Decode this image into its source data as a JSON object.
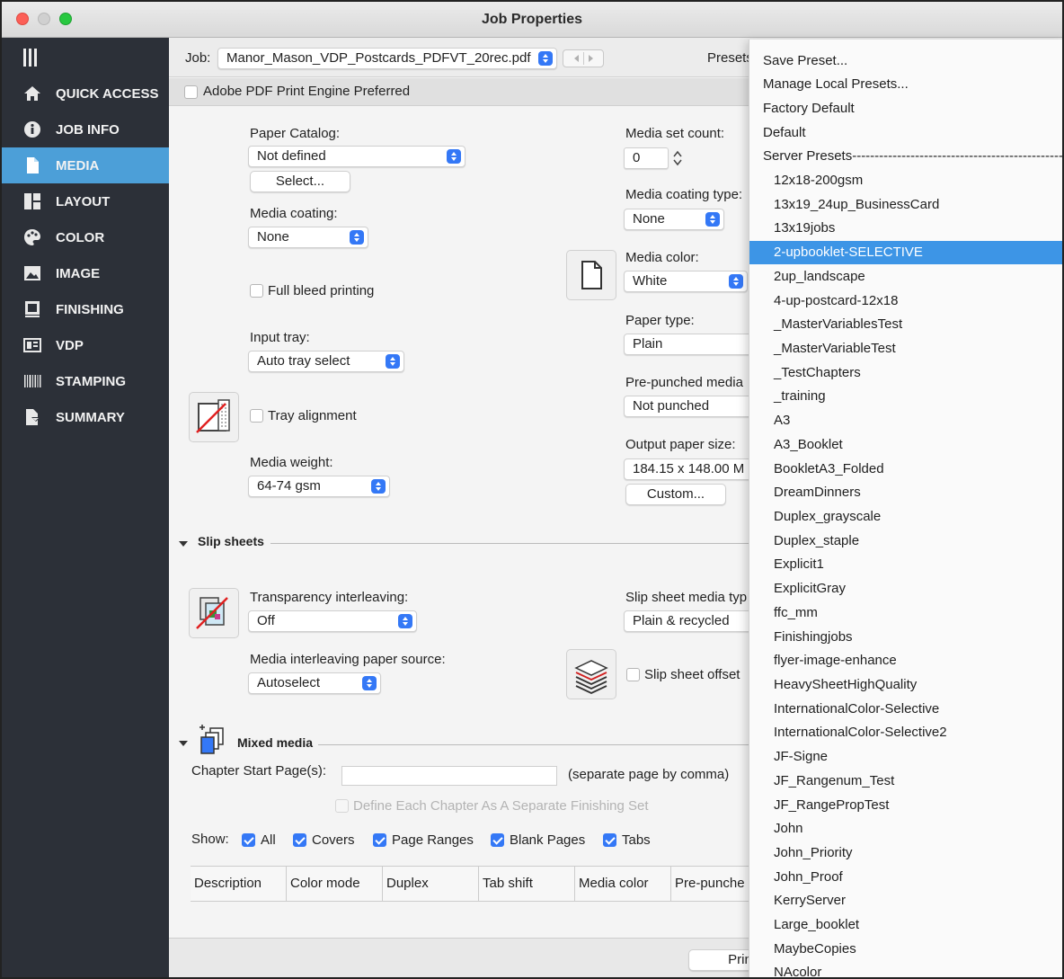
{
  "window": {
    "title": "Job Properties"
  },
  "sidebar": {
    "items": [
      {
        "label": "QUICK ACCESS",
        "icon": "home-icon"
      },
      {
        "label": "JOB INFO",
        "icon": "info-icon"
      },
      {
        "label": "MEDIA",
        "icon": "media-icon",
        "active": true
      },
      {
        "label": "LAYOUT",
        "icon": "layout-icon"
      },
      {
        "label": "COLOR",
        "icon": "palette-icon"
      },
      {
        "label": "IMAGE",
        "icon": "image-icon"
      },
      {
        "label": "FINISHING",
        "icon": "finishing-icon"
      },
      {
        "label": "VDP",
        "icon": "vdp-icon"
      },
      {
        "label": "STAMPING",
        "icon": "barcode-icon"
      },
      {
        "label": "SUMMARY",
        "icon": "summary-icon"
      }
    ]
  },
  "job": {
    "label": "Job:",
    "value": "Manor_Mason_VDP_Postcards_PDFVT_20rec.pdf",
    "presets_label": "Presets"
  },
  "pdf_engine": {
    "label": "Adobe PDF Print Engine Preferred",
    "checked": false
  },
  "media": {
    "paper_catalog_label": "Paper Catalog:",
    "paper_catalog_value": "Not defined",
    "select_button": "Select...",
    "media_coating_label": "Media coating:",
    "media_coating_value": "None",
    "full_bleed_label": "Full bleed printing",
    "input_tray_label": "Input tray:",
    "input_tray_value": "Auto tray select",
    "tray_alignment_label": "Tray alignment",
    "media_weight_label": "Media weight:",
    "media_weight_value": "64-74 gsm",
    "media_set_count_label": "Media set count:",
    "media_set_count_value": "0",
    "media_coating_type_label": "Media coating type:",
    "media_coating_type_value": "None",
    "media_color_label": "Media color:",
    "media_color_value": "White",
    "paper_type_label": "Paper type:",
    "paper_type_value": "Plain",
    "pre_punched_label": "Pre-punched media",
    "pre_punched_value": "Not punched",
    "output_paper_size_label": "Output paper size:",
    "output_paper_size_value": "184.15 x 148.00 M",
    "custom_button": "Custom..."
  },
  "slip_sheets": {
    "header": "Slip sheets",
    "transparency_label": "Transparency interleaving:",
    "transparency_value": "Off",
    "media_interleaving_label": "Media interleaving paper source:",
    "media_interleaving_value": "Autoselect",
    "slip_media_type_label": "Slip sheet media typ",
    "slip_media_type_value": "Plain & recycled",
    "slip_offset_label": "Slip sheet offset"
  },
  "mixed_media": {
    "header": "Mixed media",
    "chapter_label": "Chapter Start Page(s):",
    "chapter_value": "",
    "chapter_hint": "(separate page by comma)",
    "define_chapter_label": "Define Each Chapter As A Separate Finishing Set",
    "show_label": "Show:",
    "filters": [
      {
        "label": "All",
        "checked": true
      },
      {
        "label": "Covers",
        "checked": true
      },
      {
        "label": "Page Ranges",
        "checked": true
      },
      {
        "label": "Blank Pages",
        "checked": true
      },
      {
        "label": "Tabs",
        "checked": true
      }
    ],
    "columns": [
      "Description",
      "Color mode",
      "Duplex",
      "Tab shift",
      "Media color",
      "Pre-punche"
    ]
  },
  "footer": {
    "print_button": "Print"
  },
  "presets_menu": {
    "top_items": [
      "Save Preset...",
      "Manage Local Presets...",
      "Factory Default",
      "Default",
      "Server Presets-----------------------------------------------"
    ],
    "server_presets": [
      "12x18-200gsm",
      "13x19_24up_BusinessCard",
      "13x19jobs",
      "2-upbooklet-SELECTIVE",
      "2up_landscape",
      "4-up-postcard-12x18",
      "_MasterVariablesTest",
      "_MasterVariableTest",
      "_TestChapters",
      "_training",
      "A3",
      "A3_Booklet",
      "BookletA3_Folded",
      "DreamDinners",
      "Duplex_grayscale",
      "Duplex_staple",
      "Explicit1",
      "ExplicitGray",
      "ffc_mm",
      "Finishingjobs",
      "flyer-image-enhance",
      "HeavySheetHighQuality",
      "InternationalColor-Selective",
      "InternationalColor-Selective2",
      "JF-Signe",
      "JF_Rangenum_Test",
      "JF_RangePropTest",
      "John",
      "John_Priority",
      "John_Proof",
      "KerryServer",
      "Large_booklet",
      "MaybeCopies",
      "NAcolor"
    ],
    "selected": "2-upbooklet-SELECTIVE"
  },
  "colors": {
    "sidebar_bg": "#2c3038",
    "sidebar_active": "#4c9fd8",
    "accent": "#3478f6",
    "menu_highlight": "#3d95e6"
  }
}
